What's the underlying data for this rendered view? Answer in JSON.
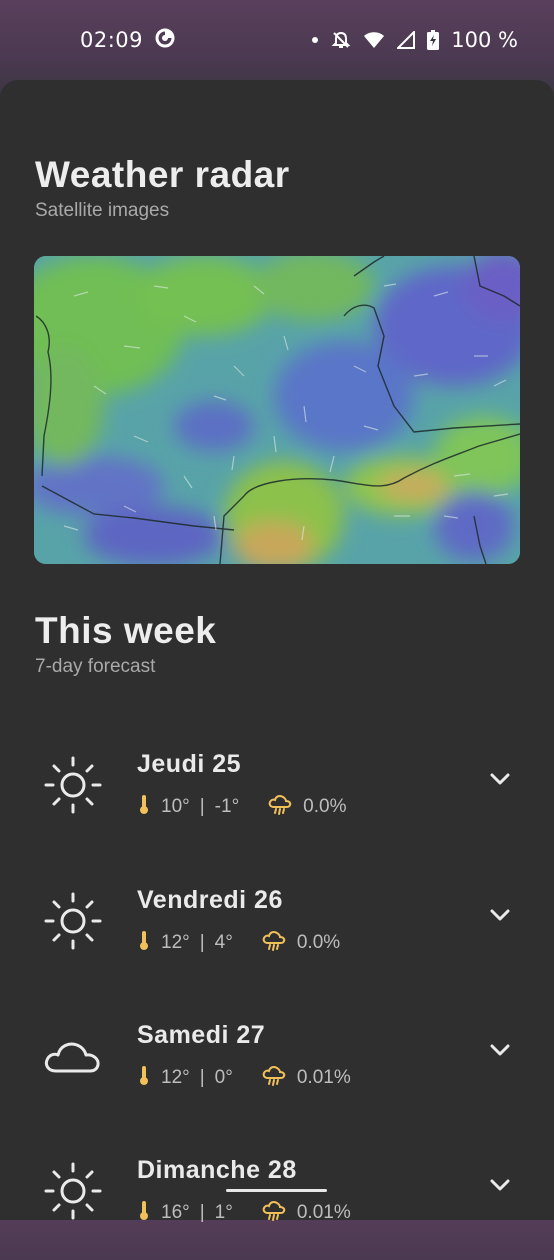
{
  "status_bar": {
    "time": "02:09",
    "battery_percent": "100 %",
    "icons": [
      "data-saver-icon",
      "dot-icon",
      "bell-off-icon",
      "wifi-icon",
      "signal-icon",
      "battery-icon"
    ]
  },
  "radar_section": {
    "title": "Weather radar",
    "subtitle": "Satellite images"
  },
  "week_section": {
    "title": "This week",
    "subtitle": "7-day forecast"
  },
  "days": [
    {
      "name": "Jeudi 25",
      "icon": "sun-icon",
      "max": "10°",
      "min": "-1°",
      "precip": "0.0%"
    },
    {
      "name": "Vendredi 26",
      "icon": "sun-icon",
      "max": "12°",
      "min": "4°",
      "precip": "0.0%"
    },
    {
      "name": "Samedi 27",
      "icon": "cloud-icon",
      "max": "12°",
      "min": "0°",
      "precip": "0.01%"
    },
    {
      "name": "Dimanche 28",
      "icon": "sun-icon",
      "max": "16°",
      "min": "1°",
      "precip": "0.01%"
    }
  ],
  "separator": "|",
  "colors": {
    "accent": "#f0c05a",
    "sheet": "#2f2f2f",
    "text": "#ececec",
    "muted": "#a9a9a9"
  }
}
